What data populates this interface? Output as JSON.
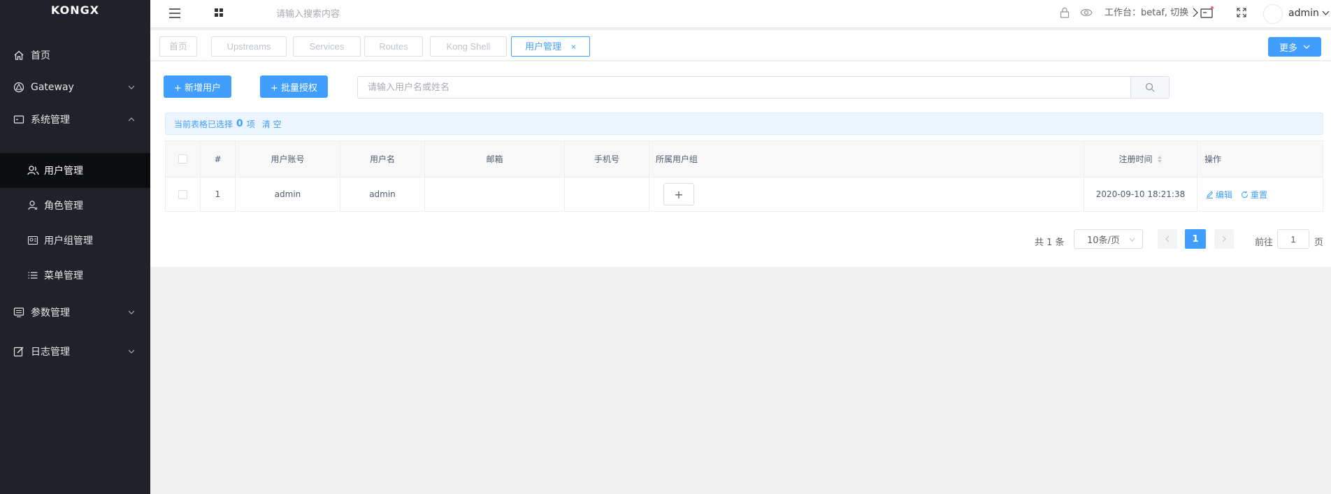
{
  "app": {
    "logo": "KONGX"
  },
  "sidebar": {
    "items": [
      {
        "label": "首页",
        "icon": "home-icon"
      },
      {
        "label": "Gateway",
        "icon": "gateway-icon"
      },
      {
        "label": "系统管理",
        "icon": "system-icon"
      },
      {
        "label": "参数管理",
        "icon": "params-icon"
      },
      {
        "label": "日志管理",
        "icon": "log-icon"
      }
    ],
    "sub_items": [
      {
        "label": "用户管理",
        "icon": "users-icon",
        "active": true
      },
      {
        "label": "角色管理",
        "icon": "role-icon"
      },
      {
        "label": "用户组管理",
        "icon": "user-group-icon"
      },
      {
        "label": "菜单管理",
        "icon": "menu-list-icon"
      }
    ]
  },
  "header": {
    "search_placeholder": "请输入搜索内容",
    "workspace": "工作台：betaf, 切换",
    "user": "admin"
  },
  "tabs": [
    {
      "label": "首页"
    },
    {
      "label": "Upstreams"
    },
    {
      "label": "Services"
    },
    {
      "label": "Routes"
    },
    {
      "label": "Kong Shell"
    },
    {
      "label": "用户管理",
      "active": true,
      "close": "×"
    }
  ],
  "more_button": "更多",
  "toolbar": {
    "add_user": "+ 新增用户",
    "batch_auth": "+ 批量授权",
    "search_placeholder": "请输入用户名或姓名"
  },
  "selection": {
    "prefix": "当前表格已选择",
    "count": "0",
    "suffix": "项",
    "clear": "清 空"
  },
  "table": {
    "columns": [
      "#",
      "用户账号",
      "用户名",
      "邮箱",
      "手机号",
      "所属用户组",
      "注册时间",
      "操作"
    ],
    "rows": [
      {
        "index": "1",
        "account": "admin",
        "username": "admin",
        "email": "",
        "phone": "",
        "group": "+",
        "created": "2020-09-10 18:21:38",
        "edit": "编辑",
        "reset": "重置"
      }
    ]
  },
  "pagination": {
    "total": "共 1 条",
    "page_size": "10条/页",
    "current": "1",
    "goto_label": "前往",
    "goto_value": "1",
    "goto_suffix": "页"
  },
  "colors": {
    "primary": "#409eff",
    "sidebar_bg": "#1f2329",
    "active_bg": "#0b0d10"
  }
}
